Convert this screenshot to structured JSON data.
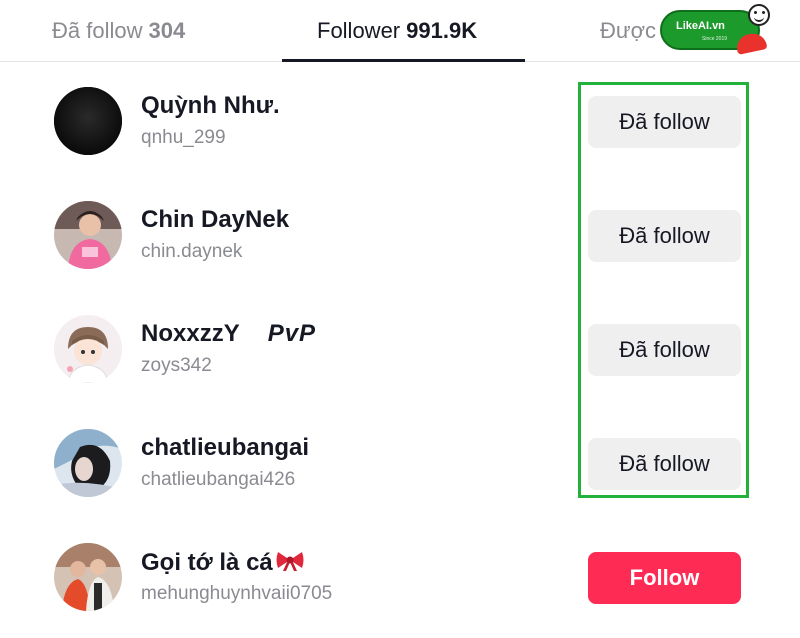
{
  "tabs": [
    {
      "label": "Đã follow",
      "count": "304"
    },
    {
      "label": "Follower",
      "count": "991.9K"
    },
    {
      "label": "Được"
    }
  ],
  "logo": {
    "text": "LikeAI.vn",
    "subtext": "Since 2019"
  },
  "users": [
    {
      "name": "Quỳnh Như.",
      "handle": "qnhu_299",
      "button": "Đã follow",
      "avatar_icon": "black-avatar"
    },
    {
      "name": "Chin DayNek",
      "handle": "chin.daynek",
      "button": "Đã follow",
      "avatar_icon": "photo-avatar"
    },
    {
      "name": "NoxxzzY",
      "name_suffix": "PvP",
      "handle": "zoys342",
      "button": "Đã follow",
      "avatar_icon": "cartoon-avatar"
    },
    {
      "name": "chatlieubangai",
      "handle": "chatlieubangai426",
      "button": "Đã follow",
      "avatar_icon": "photo-avatar"
    },
    {
      "name": "Gọi tớ là cá",
      "handle": "mehunghuynhvaii0705",
      "button": "Follow",
      "avatar_icon": "photo-avatar",
      "name_icon": "ribbon-bow-icon"
    }
  ],
  "colors": {
    "accent": "#fe2c55",
    "following_bg": "#efeff0",
    "highlight": "#22b13a",
    "text": "#161823",
    "muted": "#8a8b91"
  }
}
